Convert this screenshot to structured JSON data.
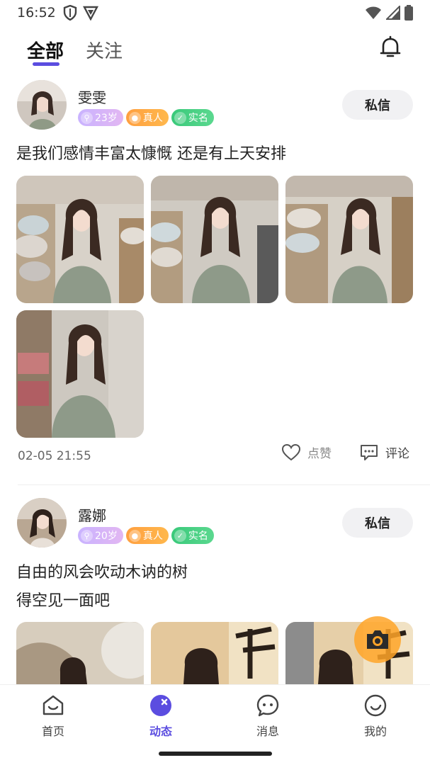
{
  "status_bar": {
    "time": "16:52"
  },
  "tabs": [
    {
      "label": "全部"
    },
    {
      "label": "关注"
    }
  ],
  "posts": [
    {
      "username": "雯雯",
      "badges": {
        "age": "23岁",
        "real": "真人",
        "verified": "实名"
      },
      "dm_label": "私信",
      "text_lines": [
        "是我们感情丰富太慷慨 还是有上天安排"
      ],
      "photo_count": 4,
      "timestamp": "02-05 21:55",
      "like_label": "点赞",
      "comment_label": "评论"
    },
    {
      "username": "露娜",
      "badges": {
        "age": "20岁",
        "real": "真人",
        "verified": "实名"
      },
      "dm_label": "私信",
      "text_lines": [
        "自由的风会吹动木讷的树",
        "得空见一面吧"
      ],
      "photo_count": 3
    }
  ],
  "bottom_nav": [
    {
      "label": "首页",
      "icon": "home-icon",
      "active": false
    },
    {
      "label": "动态",
      "icon": "moments-icon",
      "active": true
    },
    {
      "label": "消息",
      "icon": "message-icon",
      "active": false
    },
    {
      "label": "我的",
      "icon": "profile-icon",
      "active": false
    }
  ],
  "colors": {
    "accent": "#5b4de0",
    "age_badge": "#d4b4fa",
    "real_badge": "#ffa845",
    "verified_badge": "#43cf84"
  }
}
